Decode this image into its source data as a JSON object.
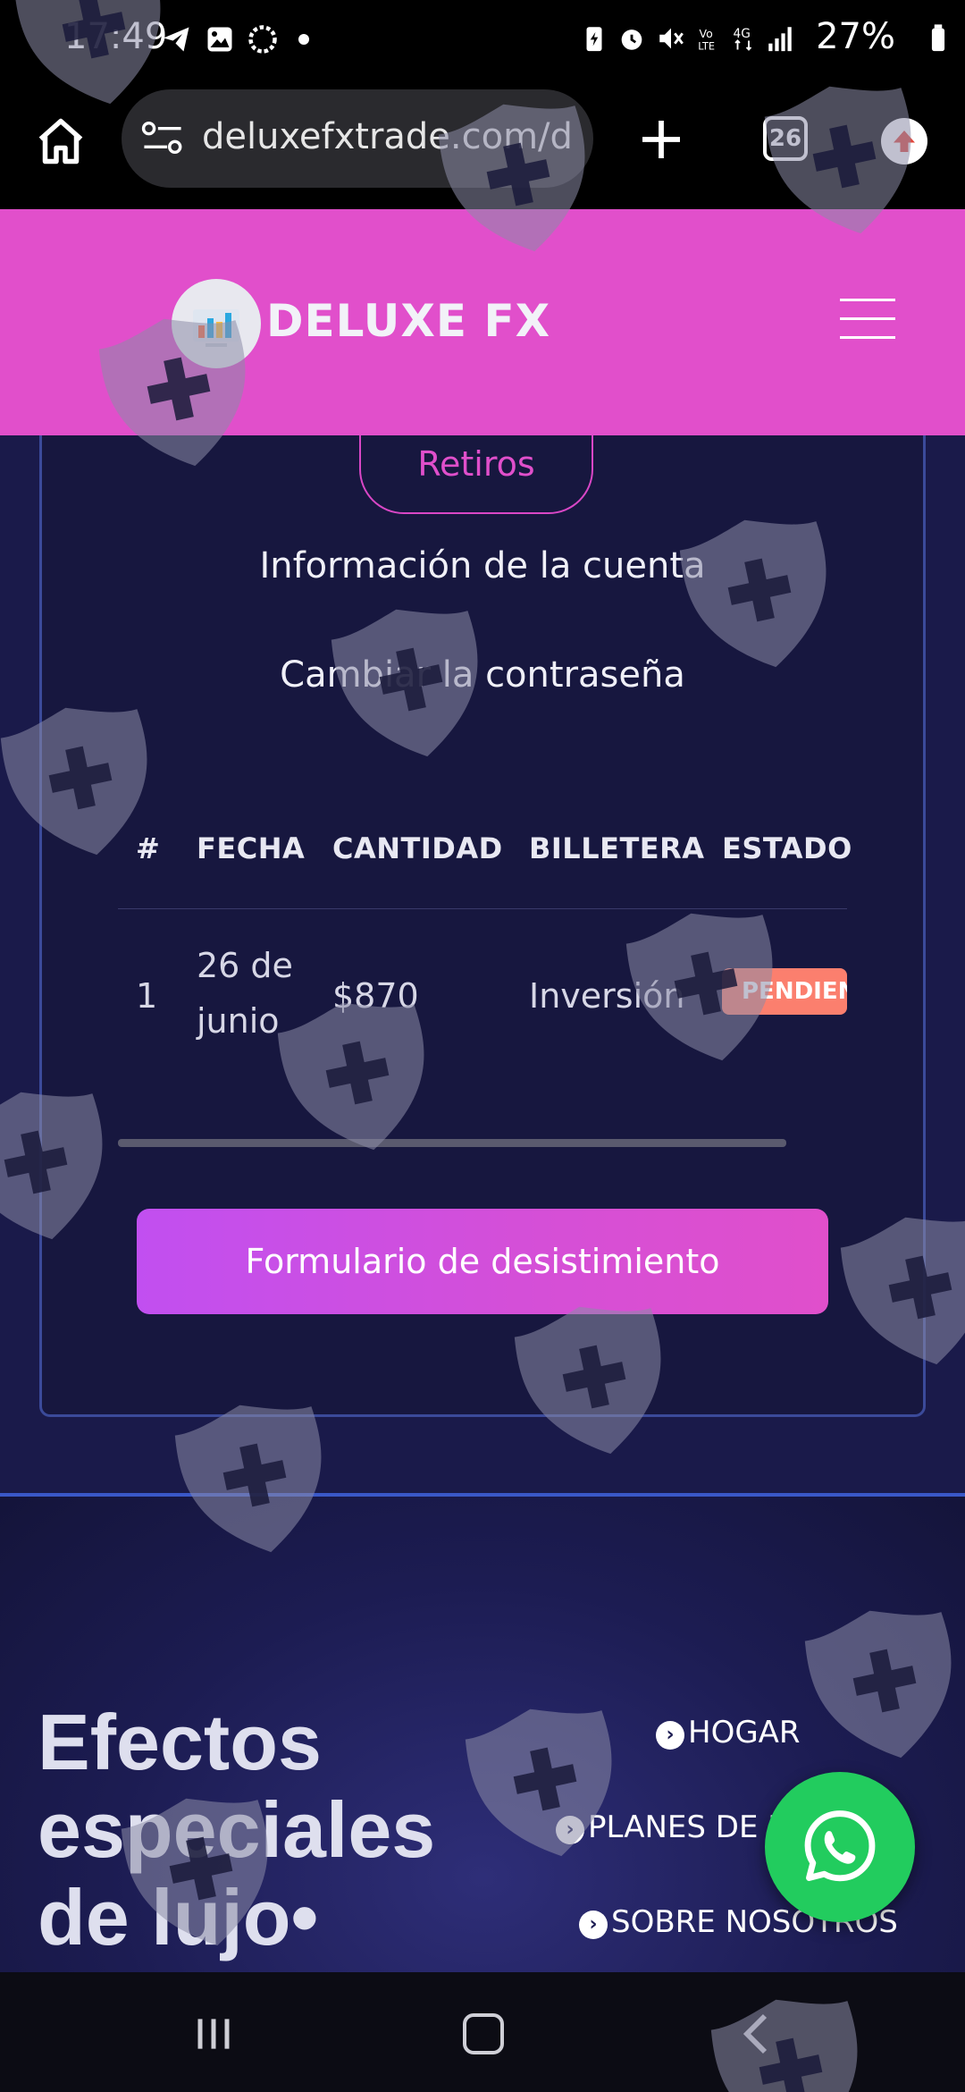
{
  "status_bar": {
    "time": "17:49",
    "battery": "27%",
    "icons_left": [
      "telegram-icon",
      "gallery-icon",
      "sync-icon",
      "dot-icon"
    ],
    "icons_right": [
      "battery-saver-icon",
      "alarm-icon",
      "mute-icon",
      "volte-icon",
      "4g-icon",
      "signal-icon",
      "battery-icon"
    ]
  },
  "browser": {
    "url": "deluxefxtrade.com/d",
    "tab_count": "26"
  },
  "header": {
    "logo_text": "DELUXE FX"
  },
  "account_menu": {
    "withdrawals_tab": "Retiros",
    "account_info": "Información de la cuenta",
    "change_password": "Cambiar la contraseña"
  },
  "table": {
    "columns": [
      "#",
      "FECHA",
      "CANTIDAD",
      "BILLETERA",
      "ESTADO"
    ],
    "rows": [
      {
        "num": "1",
        "date_line1": "26 de",
        "date_line2": "junio",
        "amount": "$870",
        "wallet": "Inversión",
        "status": "PENDIENTE"
      }
    ]
  },
  "withdraw_form_button": "Formulario de desistimiento",
  "footer": {
    "brand_line1": "Efectos",
    "brand_line2": "especiales",
    "brand_line3": "de lujo•",
    "links": [
      "HOGAR",
      "PLANES DE INVERSIÓN",
      "SOBRE NOSOTROS"
    ]
  },
  "colors": {
    "header_pink": "#e14fcb",
    "background_navy": "#17173f",
    "button_gradient_start": "#c14ff0",
    "status_badge": "#fb7f6e",
    "whatsapp_green": "#22cc5e"
  }
}
